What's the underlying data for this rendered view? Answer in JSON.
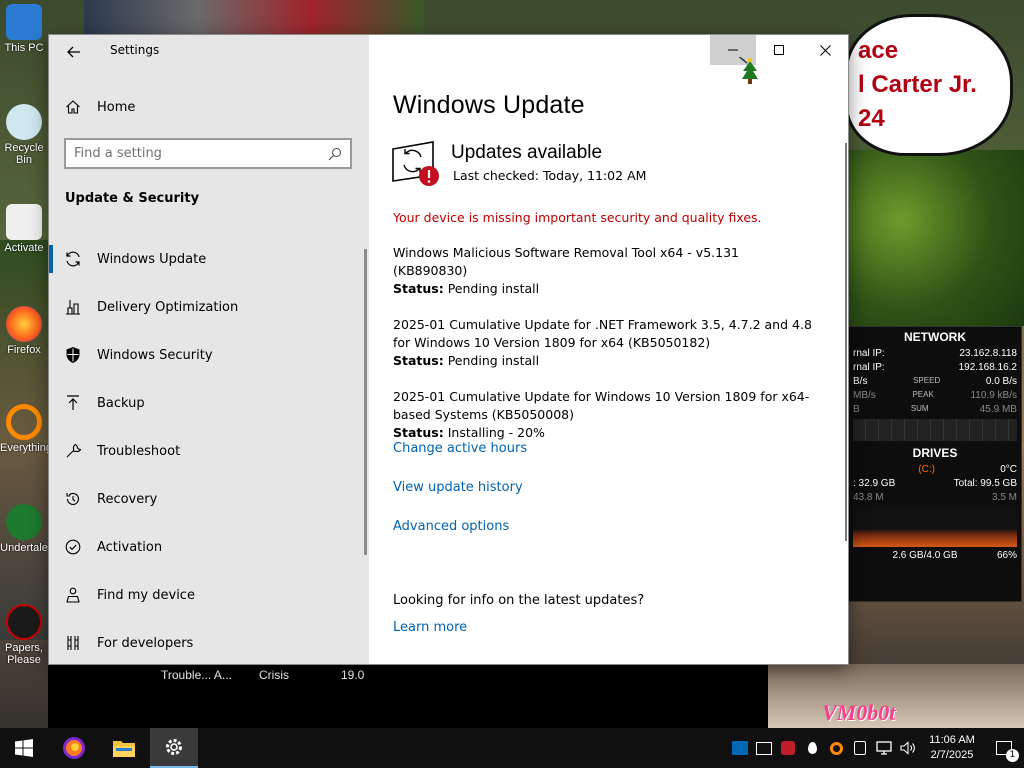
{
  "desktop": {
    "icons": [
      "This PC",
      "Recycle Bin",
      "Activate",
      "Firefox",
      "Everything",
      "Undertale",
      "Papers, Please"
    ],
    "bubble_text": "ace\nl Carter Jr.\n24",
    "watermark": "VM0b0t"
  },
  "widget": {
    "network": {
      "title": "NETWORK",
      "external_ip_label": "rnal IP:",
      "external_ip": "23.162.8.118",
      "internal_ip_label": "rnal IP:",
      "internal_ip": "192.168.16.2",
      "speed": {
        "left": "B/s",
        "label": "SPEED",
        "right": "0.0 B/s"
      },
      "peak": {
        "left": "MB/s",
        "label": "PEAK",
        "right": "110.9 kB/s"
      },
      "sum": {
        "left": "B",
        "label": "SUM",
        "right": "45.9 MB"
      }
    },
    "drives": {
      "title": "DRIVES",
      "drive": "(C:)",
      "temp": "0°C",
      "used": ": 32.9 GB",
      "total": "Total: 99.5 GB",
      "read": "43.8 M",
      "write": "3.5 M",
      "ram": "2.6 GB/4.0 GB",
      "ram_percent": "66%"
    }
  },
  "window": {
    "title": "Settings",
    "home_label": "Home",
    "search_placeholder": "Find a setting",
    "section_label": "Update & Security",
    "nav_items": [
      {
        "label": "Windows Update",
        "icon": "sync-icon"
      },
      {
        "label": "Delivery Optimization",
        "icon": "delivery-icon"
      },
      {
        "label": "Windows Security",
        "icon": "shield-icon"
      },
      {
        "label": "Backup",
        "icon": "backup-icon"
      },
      {
        "label": "Troubleshoot",
        "icon": "wrench-icon"
      },
      {
        "label": "Recovery",
        "icon": "recovery-icon"
      },
      {
        "label": "Activation",
        "icon": "check-circle-icon"
      },
      {
        "label": "Find my device",
        "icon": "person-location-icon"
      },
      {
        "label": "For developers",
        "icon": "developer-icon"
      }
    ],
    "active_nav": 0
  },
  "main": {
    "heading": "Windows Update",
    "status_title": "Updates available",
    "status_sub": "Last checked: Today, 11:02 AM",
    "warning": "Your device is missing important security and quality fixes.",
    "status_key": "Status:",
    "updates": [
      {
        "name": "Windows Malicious Software Removal Tool x64 - v5.131 (KB890830)",
        "status": "Pending install"
      },
      {
        "name": "2025-01 Cumulative Update for .NET Framework 3.5, 4.7.2 and 4.8 for Windows 10 Version 1809 for x64 (KB5050182)",
        "status": "Pending install"
      },
      {
        "name": "2025-01 Cumulative Update for Windows 10 Version 1809 for x64-based Systems (KB5050008)",
        "status": "Installing - 20%"
      }
    ],
    "links": {
      "active_hours": "Change active hours",
      "history": "View update history",
      "advanced": "Advanced options"
    },
    "info_question": "Looking for info on the latest updates?",
    "learn_more": "Learn more"
  },
  "behind_strip": {
    "col1": "Trouble... A...",
    "col2": "Crisis",
    "col3": "19.0"
  },
  "taskbar": {
    "time": "11:06 AM",
    "date": "2/7/2025",
    "notification_count": "1",
    "apps": [
      "windows-start-icon",
      "firefox-icon",
      "file-explorer-icon",
      "settings-gear-icon"
    ]
  },
  "colors": {
    "accent": "#0063b1",
    "warning": "#c00000",
    "sidebar_bg": "#e6e6e6"
  }
}
